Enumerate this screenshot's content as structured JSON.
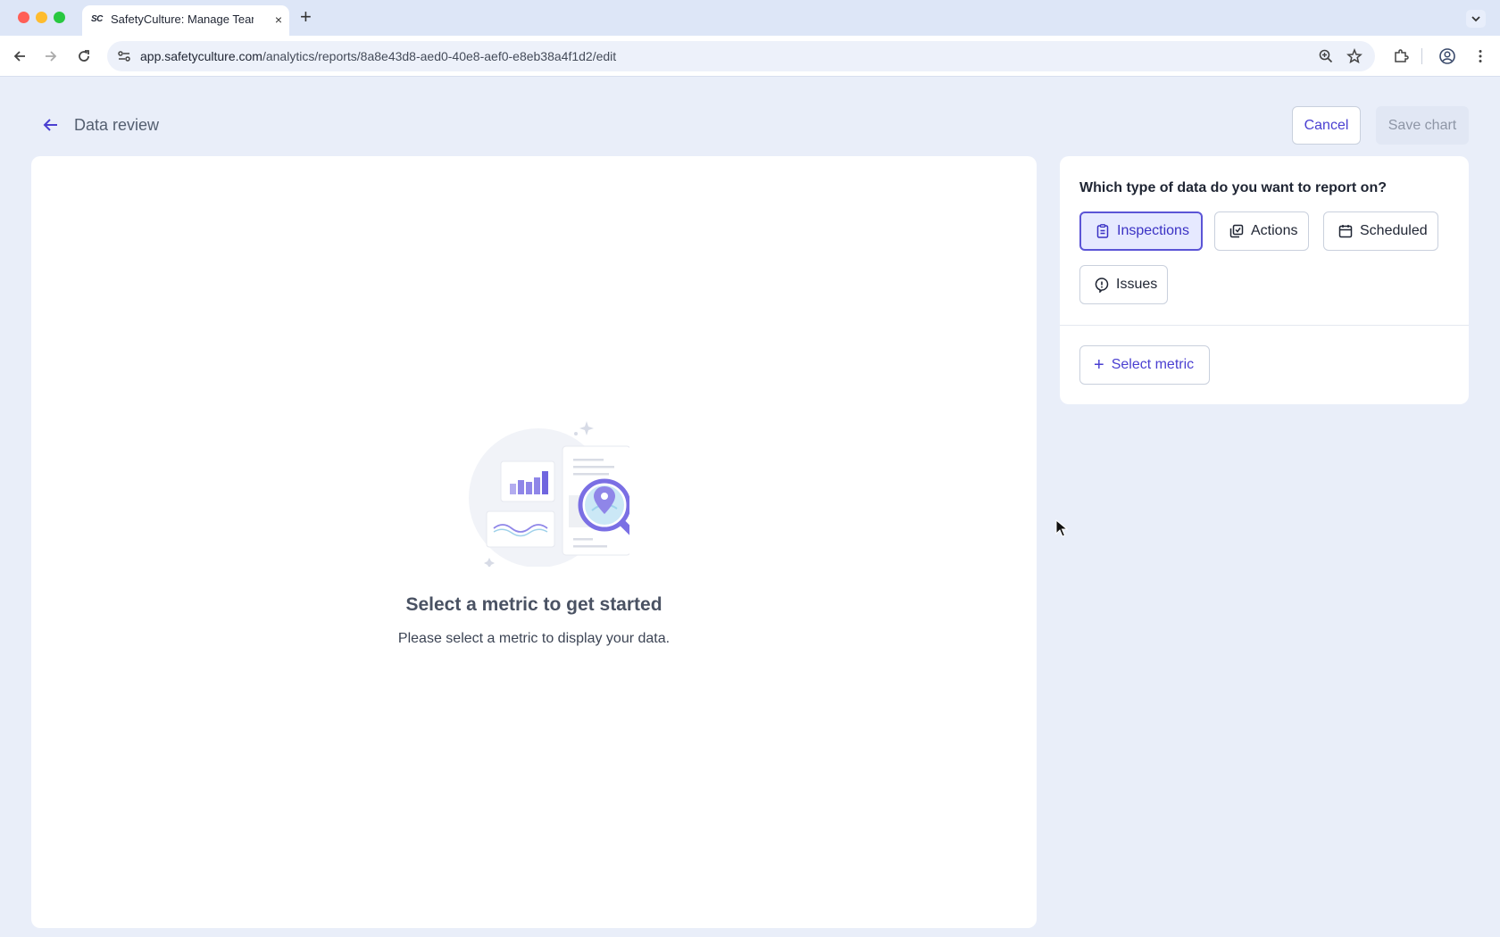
{
  "browser": {
    "tab_title": "SafetyCulture: Manage Teams",
    "tab_favicon_text": "SC",
    "url_domain": "app.safetyculture.com",
    "url_path": "/analytics/reports/8a8e43d8-aed0-40e8-aef0-e8eb38a4f1d2/edit",
    "new_tab_symbol": "+",
    "close_symbol": "×"
  },
  "header": {
    "title": "Data review",
    "cancel_label": "Cancel",
    "save_label": "Save chart"
  },
  "empty_state": {
    "title": "Select a metric to get started",
    "subtitle": "Please select a metric to display your data."
  },
  "data_type_panel": {
    "question": "Which type of data do you want to report on?",
    "options": [
      {
        "label": "Inspections",
        "icon": "clipboard-icon",
        "selected": true
      },
      {
        "label": "Actions",
        "icon": "actions-icon",
        "selected": false
      },
      {
        "label": "Scheduled",
        "icon": "calendar-icon",
        "selected": false
      },
      {
        "label": "Issues",
        "icon": "alert-bubble-icon",
        "selected": false
      }
    ],
    "select_metric_label": "Select metric",
    "select_metric_symbol": "+"
  },
  "colors": {
    "accent": "#4a3fd1",
    "selected_bg": "#e6e9ff",
    "page_bg": "#e9eef9"
  }
}
